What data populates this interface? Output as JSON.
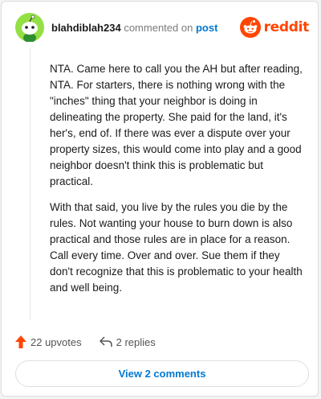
{
  "header": {
    "username": "blahdiblah234",
    "action_text": "commented on",
    "post_link": "post",
    "brand": "reddit"
  },
  "comment": {
    "paragraphs": [
      "NTA. Came here to call you the AH but after reading, NTA. For starters, there is nothing wrong with the \"inches\" thing that your neighbor is doing in delineating the property. She paid for the land, it's her's, end of. If there was ever a dispute over your property sizes, this would come into play and a good neighbor doesn't think this is problematic but practical.",
      "With that said, you live by the rules you die by the rules. Not wanting your house to burn down is also practical and those rules are in place for a reason. Call every time. Over and over. Sue them if they don't recognize that this is problematic to your health and well being."
    ]
  },
  "footer": {
    "upvotes": "22 upvotes",
    "replies": "2 replies",
    "view_comments": "View 2 comments"
  },
  "colors": {
    "brand_orange": "#ff4500",
    "link_blue": "#0079d3",
    "avatar_green": "#94e044"
  }
}
